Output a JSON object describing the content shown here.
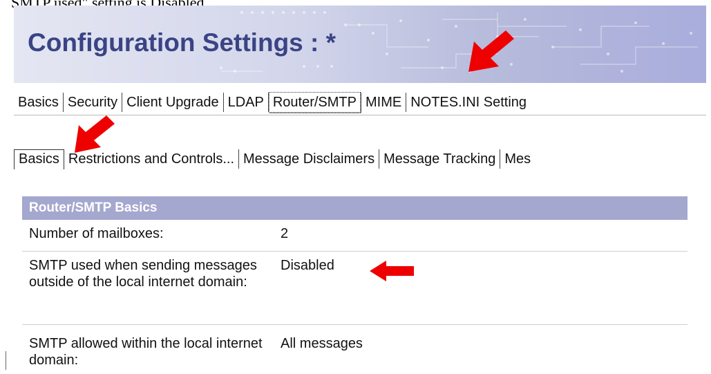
{
  "caption": "SMTP used\" setting is Disabled.",
  "banner": {
    "title": "Configuration Settings : *"
  },
  "main_tabs": [
    {
      "label": "Basics"
    },
    {
      "label": "Security"
    },
    {
      "label": "Client Upgrade"
    },
    {
      "label": "LDAP"
    },
    {
      "label": "Router/SMTP",
      "selected": true
    },
    {
      "label": "MIME"
    },
    {
      "label": "NOTES.INI Setting"
    }
  ],
  "sub_tabs": [
    {
      "label": "Basics",
      "selected": true
    },
    {
      "label": "Restrictions and Controls..."
    },
    {
      "label": "Message Disclaimers"
    },
    {
      "label": "Message Tracking"
    },
    {
      "label": "Mes"
    }
  ],
  "section": {
    "title": "Router/SMTP Basics",
    "rows": [
      {
        "label": "Number of mailboxes:",
        "value": "2"
      },
      {
        "label": "SMTP used when sending messages outside of the local internet domain:",
        "value": "Disabled"
      },
      {
        "label": "SMTP allowed within the local internet domain:",
        "value": "All messages"
      }
    ]
  },
  "colors": {
    "arrow": "#ee0000",
    "section_header": "#a4a8cf",
    "title": "#3a4484"
  }
}
